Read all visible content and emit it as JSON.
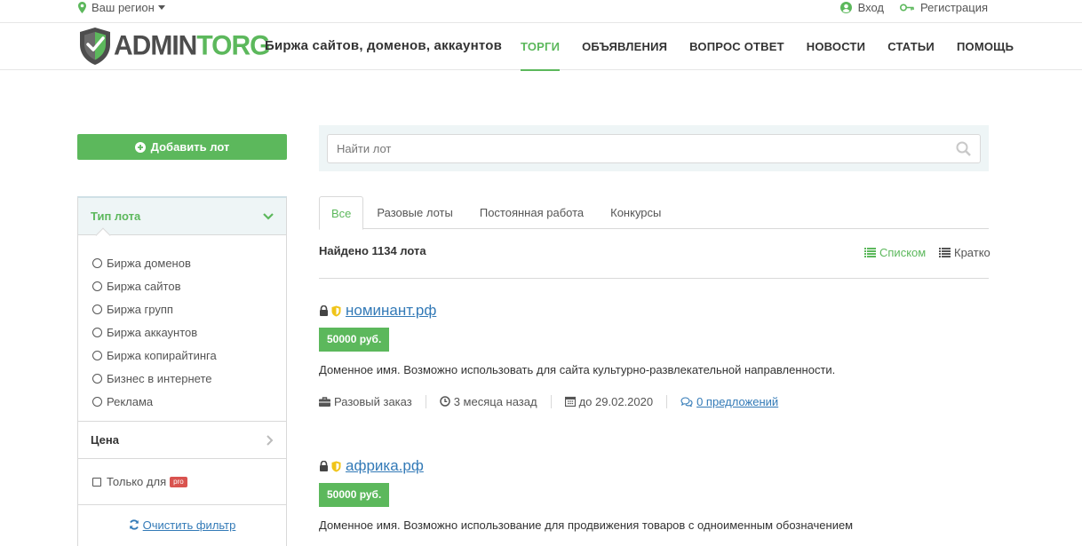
{
  "topbar": {
    "region_label": "Ваш регион",
    "login_label": "Вход",
    "register_label": "Регистрация"
  },
  "header": {
    "logo_part1": "ADMIN",
    "logo_part2": "TORG",
    "tagline": "Биржа сайтов, доменов, аккаунтов",
    "nav": [
      {
        "label": "ТОРГИ",
        "active": true
      },
      {
        "label": "ОБЪЯВЛЕНИЯ",
        "active": false
      },
      {
        "label": "ВОПРОС ОТВЕТ",
        "active": false
      },
      {
        "label": "НОВОСТИ",
        "active": false
      },
      {
        "label": "СТАТЬИ",
        "active": false
      },
      {
        "label": "ПОМОЩЬ",
        "active": false
      }
    ]
  },
  "sidebar": {
    "add_button_label": "Добавить лот",
    "type_header": "Тип лота",
    "types": [
      "Биржа доменов",
      "Биржа сайтов",
      "Биржа групп",
      "Биржа аккаунтов",
      "Биржа копирайтинга",
      "Бизнес в интернете",
      "Реклама"
    ],
    "price_label": "Цена",
    "only_for_label": "Только для",
    "pro_badge": "pro",
    "clear_filter_label": "Очистить фильтр"
  },
  "main": {
    "search_placeholder": "Найти лот",
    "tabs": [
      {
        "label": "Все",
        "active": true
      },
      {
        "label": "Разовые лоты",
        "active": false
      },
      {
        "label": "Постоянная работа",
        "active": false
      },
      {
        "label": "Конкурсы",
        "active": false
      }
    ],
    "found_text": "Найдено 1134 лота",
    "view_list_label": "Списком",
    "view_short_label": "Кратко",
    "lots": [
      {
        "title": "номинант.рф",
        "price": "50000 руб.",
        "description": "Доменное имя. Возможно использовать для сайта культурно-развлекательной направленности.",
        "order_type": "Разовый заказ",
        "age": "3 месяца назад",
        "deadline": "до 29.02.2020",
        "offers": "0 предложений"
      },
      {
        "title": "африка.рф",
        "price": "50000 руб.",
        "description": "Доменное имя. Возможно использование для продвижения товаров с одноименным обозначением"
      }
    ]
  },
  "colors": {
    "accent": "#5cb85c",
    "link": "#337ab7",
    "panel_bg": "#eef5f6",
    "badge_red": "#d9534f",
    "shield_yellow": "#f0c419"
  },
  "icons": [
    "map-marker-icon",
    "caret-down-icon",
    "user-circle-icon",
    "key-icon",
    "plus-circle-icon",
    "chevron-down-icon",
    "chevron-right-icon",
    "refresh-icon",
    "search-icon",
    "list-icon",
    "lock-icon",
    "shield-icon",
    "briefcase-icon",
    "clock-icon",
    "calendar-icon",
    "comments-icon"
  ]
}
